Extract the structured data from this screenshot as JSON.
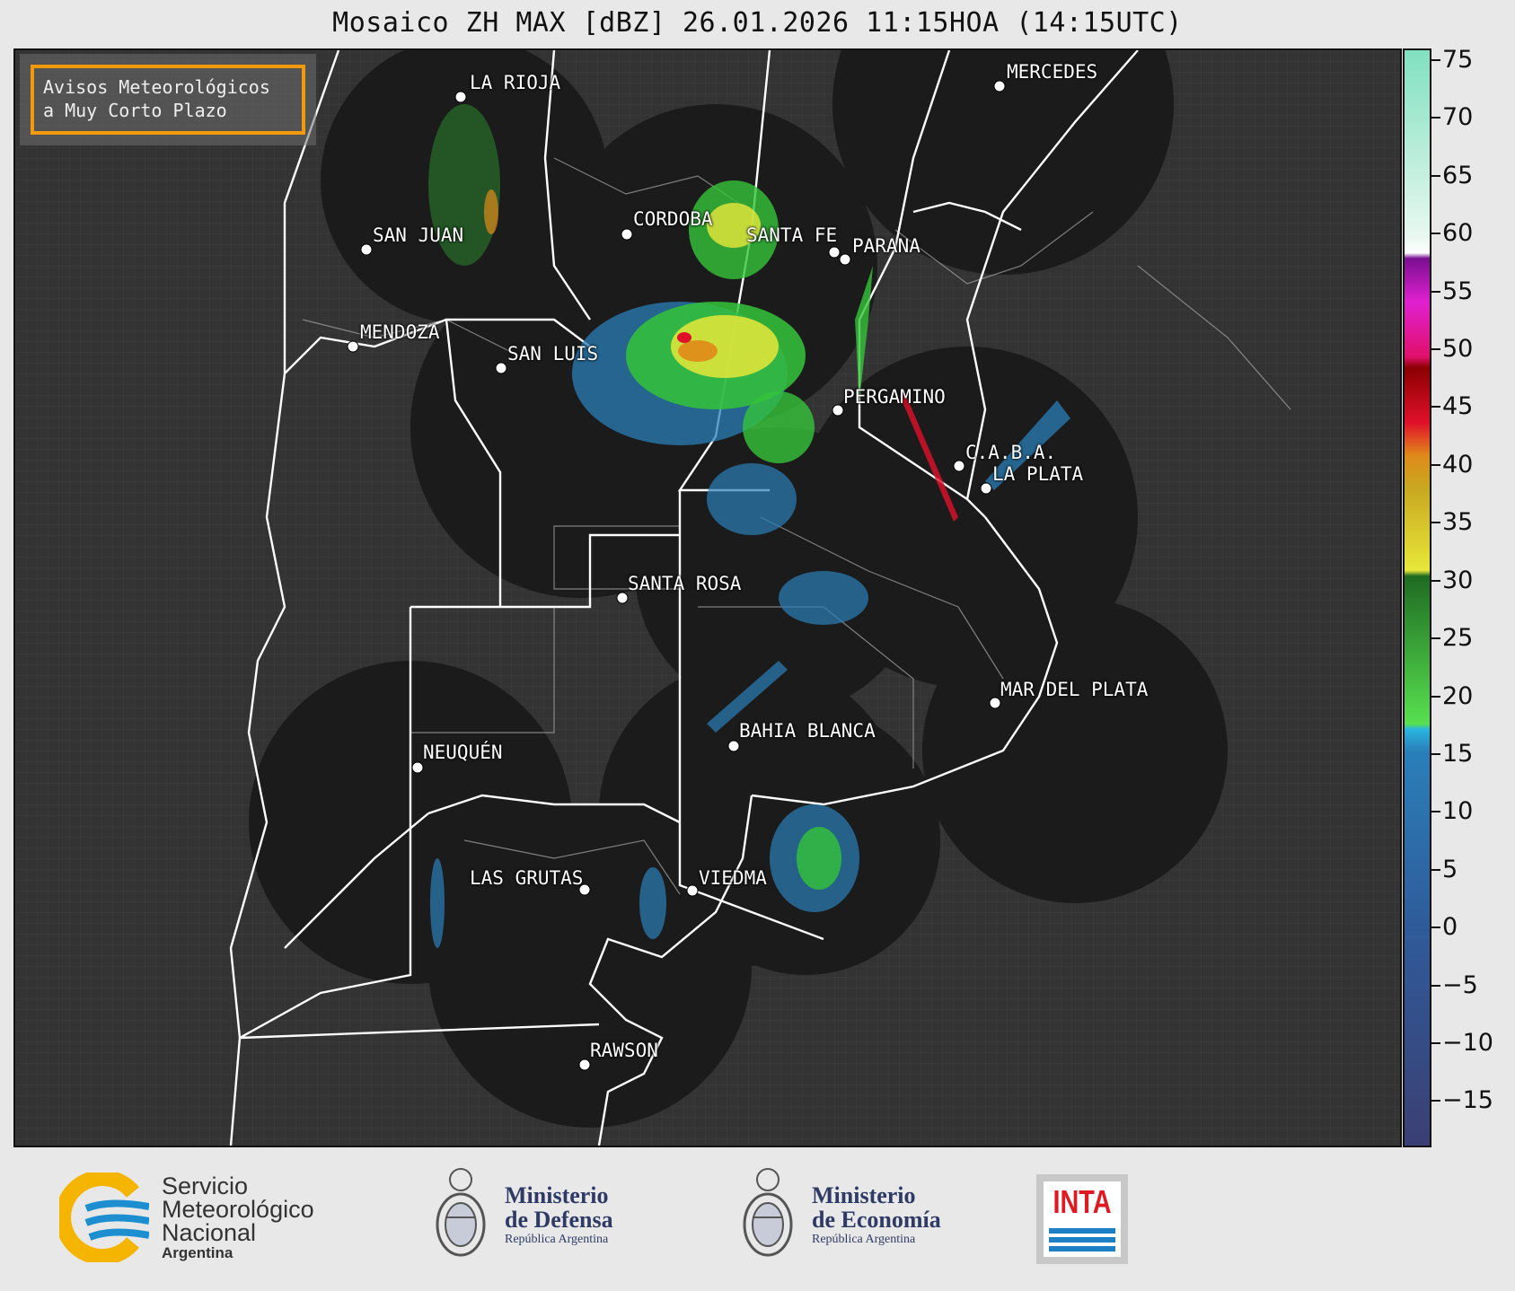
{
  "title": "Mosaico ZH MAX [dBZ] 26.01.2026 11:15HOA (14:15UTC)",
  "overlay": {
    "line1": "Avisos Meteorológicos",
    "line2": "a Muy Corto Plazo"
  },
  "cities": [
    {
      "name": "LA RIOJA",
      "label": "LA RIOJA"
    },
    {
      "name": "MERCEDES",
      "label": "MERCEDES"
    },
    {
      "name": "CORDOBA",
      "label": "CORDOBA"
    },
    {
      "name": "SAN JUAN",
      "label": "SAN JUAN"
    },
    {
      "name": "SANTA FE",
      "label": "SANTA FE"
    },
    {
      "name": "PARANA",
      "label": "PARANA"
    },
    {
      "name": "MENDOZA",
      "label": "MENDOZA"
    },
    {
      "name": "SAN LUIS",
      "label": "SAN LUIS"
    },
    {
      "name": "PERGAMINO",
      "label": "PERGAMINO"
    },
    {
      "name": "CABA",
      "label": "C.A.B.A."
    },
    {
      "name": "LA PLATA",
      "label": "LA PLATA"
    },
    {
      "name": "SANTA ROSA",
      "label": "SANTA ROSA"
    },
    {
      "name": "MAR DEL PLATA",
      "label": "MAR DEL PLATA"
    },
    {
      "name": "BAHIA BLANCA",
      "label": "BAHIA BLANCA"
    },
    {
      "name": "NEUQUEN",
      "label": "NEUQUÉN"
    },
    {
      "name": "LAS GRUTAS",
      "label": "LAS GRUTAS"
    },
    {
      "name": "VIEDMA",
      "label": "VIEDMA"
    },
    {
      "name": "RAWSON",
      "label": "RAWSON"
    }
  ],
  "colorbar": {
    "unit": "dBZ",
    "min": -19,
    "max": 76,
    "ticks": [
      "75",
      "70",
      "65",
      "60",
      "55",
      "50",
      "45",
      "40",
      "35",
      "30",
      "25",
      "20",
      "15",
      "10",
      "5",
      "0",
      "−5",
      "−10",
      "−15"
    ],
    "tick_values": [
      75,
      70,
      65,
      60,
      55,
      50,
      45,
      40,
      35,
      30,
      25,
      20,
      15,
      10,
      5,
      0,
      -5,
      -10,
      -15
    ],
    "colors": {
      "low": "#3b3f73",
      "blue": "#2a7fb8",
      "cyan": "#29b4e0",
      "green": "#34c43a",
      "darkgreen": "#1f6b22",
      "yellow": "#e8e83a",
      "orange": "#e08a1a",
      "red": "#e0102a",
      "darkred": "#8b0000",
      "magenta": "#e020d0",
      "purple": "#7a1090",
      "white": "#ffffff",
      "mint": "#80e0c0"
    }
  },
  "logos": {
    "smn": {
      "line1": "Servicio",
      "line2": "Meteorológico",
      "line3": "Nacional",
      "line4": "Argentina"
    },
    "defensa": {
      "line1": "Ministerio",
      "line2": "de Defensa",
      "line3": "República Argentina"
    },
    "economia": {
      "line1": "Ministerio",
      "line2": "de Economía",
      "line3": "República Argentina"
    },
    "inta": {
      "text": "INTA"
    }
  }
}
